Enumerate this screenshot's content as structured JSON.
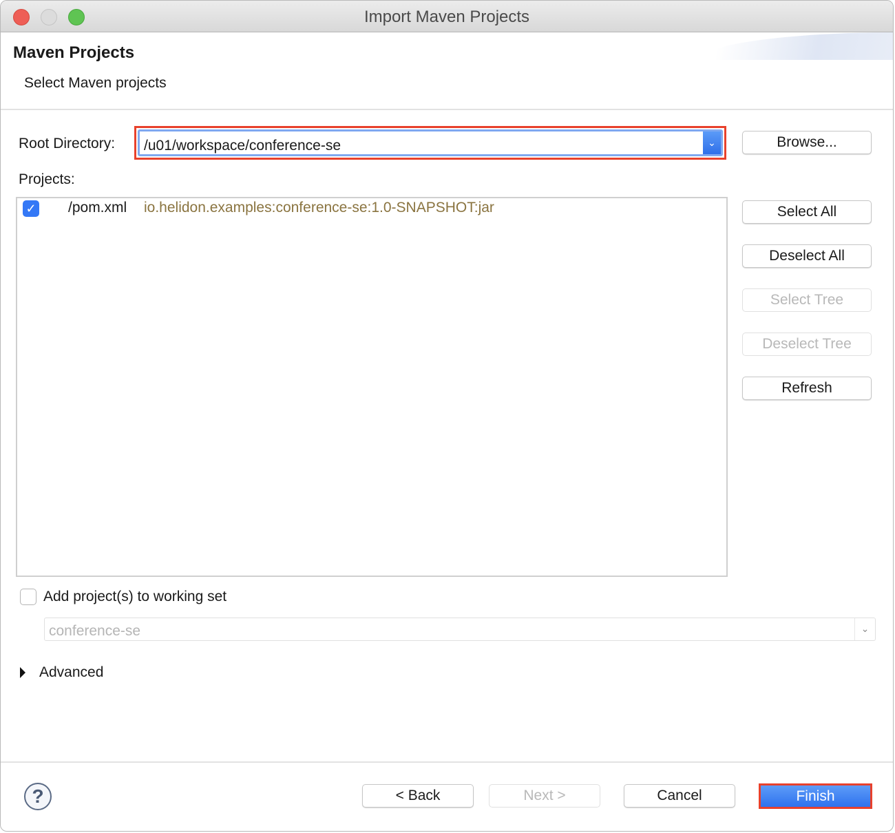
{
  "window": {
    "title": "Import Maven Projects"
  },
  "header": {
    "title": "Maven Projects",
    "subtitle": "Select Maven projects"
  },
  "root": {
    "label": "Root Directory:",
    "value": "/u01/workspace/conference-se",
    "browse": "Browse..."
  },
  "projects": {
    "label": "Projects:",
    "items": [
      {
        "checked": true,
        "path": "/pom.xml",
        "artifact": "io.helidon.examples:conference-se:1.0-SNAPSHOT:jar"
      }
    ]
  },
  "side_buttons": {
    "select_all": "Select All",
    "deselect_all": "Deselect All",
    "select_tree": "Select Tree",
    "deselect_tree": "Deselect Tree",
    "refresh": "Refresh"
  },
  "working_set": {
    "label": "Add project(s) to working set",
    "checked": false,
    "value": "conference-se"
  },
  "advanced": {
    "label": "Advanced"
  },
  "footer": {
    "back": "< Back",
    "next": "Next >",
    "cancel": "Cancel",
    "finish": "Finish"
  },
  "colors": {
    "accent": "#3478f6",
    "highlight": "#e8412c",
    "artifact": "#8a7440"
  }
}
